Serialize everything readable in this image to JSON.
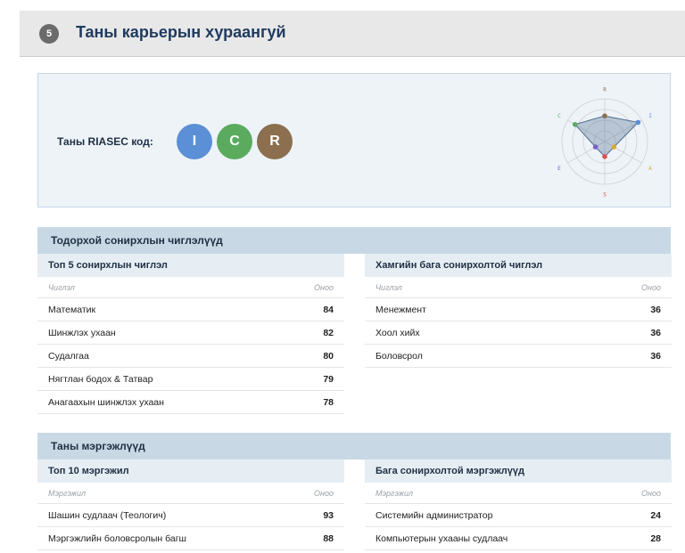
{
  "section": {
    "number": "5",
    "title": "Таны карьерын хураангуй"
  },
  "riasec": {
    "label": "Таны RIASEC код:",
    "codes": [
      {
        "letter": "I",
        "color": "#5b8fd6"
      },
      {
        "letter": "C",
        "color": "#5aab5e"
      },
      {
        "letter": "R",
        "color": "#8b6f4e"
      }
    ],
    "radar": {
      "axes": [
        {
          "label": "R",
          "color": "#8b6f4e"
        },
        {
          "label": "I",
          "color": "#5b8fd6"
        },
        {
          "label": "A",
          "color": "#e0a82e"
        },
        {
          "label": "S",
          "color": "#d9534f"
        },
        {
          "label": "E",
          "color": "#7b5fc7"
        },
        {
          "label": "C",
          "color": "#5aab5e"
        }
      ],
      "values": [
        0.6,
        0.9,
        0.25,
        0.35,
        0.25,
        0.8
      ]
    }
  },
  "interests": {
    "header": "Тодорхой сонирхлын чиглэлүүд",
    "top": {
      "title": "Топ 5 сонирхлын чиглэл",
      "col_name": "Чиглэл",
      "col_score": "Оноо",
      "rows": [
        {
          "name": "Математик",
          "score": "84"
        },
        {
          "name": "Шинжлэх ухаан",
          "score": "82"
        },
        {
          "name": "Судалгаа",
          "score": "80"
        },
        {
          "name": "Нягтлан бодох & Татвар",
          "score": "79"
        },
        {
          "name": "Анагаахын шинжлэх ухаан",
          "score": "78"
        }
      ]
    },
    "low": {
      "title": "Хамгийн бага сонирхолтой чиглэл",
      "col_name": "Чиглэл",
      "col_score": "Оноо",
      "rows": [
        {
          "name": "Менежмент",
          "score": "36"
        },
        {
          "name": "Хоол хийх",
          "score": "36"
        },
        {
          "name": "Боловсрол",
          "score": "36"
        }
      ]
    }
  },
  "careers": {
    "header": "Таны мэргэжлүүд",
    "top": {
      "title": "Топ 10 мэргэжил",
      "col_name": "Мэргэжил",
      "col_score": "Оноо",
      "rows": [
        {
          "name": "Шашин судлаач (Теологич)",
          "score": "93"
        },
        {
          "name": "Мэргэжлийн боловсролын багш",
          "score": "88"
        }
      ]
    },
    "low": {
      "title": "Бага сонирхолтой мэргэжлүүд",
      "col_name": "Мэргэжил",
      "col_score": "Оноо",
      "rows": [
        {
          "name": "Системийн администратор",
          "score": "24"
        },
        {
          "name": "Компьютерын ухааны судлаач",
          "score": "28"
        }
      ]
    }
  }
}
